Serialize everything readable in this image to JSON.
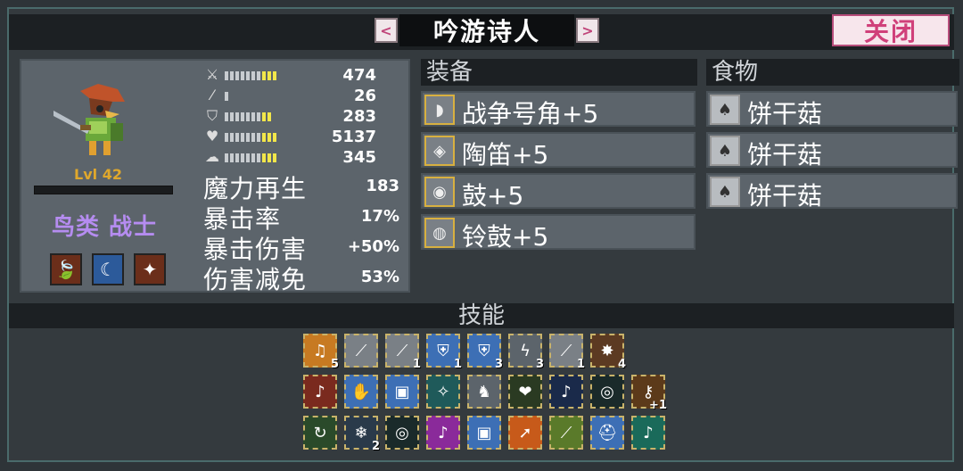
{
  "header": {
    "title": "吟游诗人",
    "prev_label": "<",
    "next_label": ">",
    "close_label": "关闭"
  },
  "character": {
    "level": "Lvl 42",
    "class": "鸟类 战士",
    "traits": [
      {
        "icon": "leaf-arrow-up-icon",
        "color": "#6b2e1a"
      },
      {
        "icon": "moon-shield-icon",
        "color": "#2c5a9a"
      },
      {
        "icon": "sparkle-icon",
        "color": "#6b2e1a"
      }
    ],
    "stats": [
      {
        "icon": "sword-icon",
        "value": "474",
        "pips": 10,
        "yellow": 3
      },
      {
        "icon": "wand-icon",
        "value": "26",
        "pips": 1,
        "yellow": 0
      },
      {
        "icon": "shield-icon",
        "value": "283",
        "pips": 9,
        "yellow": 2
      },
      {
        "icon": "heart-icon",
        "value": "5137",
        "pips": 10,
        "yellow": 3
      },
      {
        "icon": "speed-icon",
        "value": "345",
        "pips": 10,
        "yellow": 3
      }
    ],
    "sub_stats": [
      {
        "label": "魔力再生",
        "value": "183"
      },
      {
        "label": "暴击率",
        "value": "17%"
      },
      {
        "label": "暴击伤害",
        "value": "+50%"
      },
      {
        "label": "伤害减免",
        "value": "53%"
      }
    ]
  },
  "equipment": {
    "header": "装备",
    "items": [
      {
        "label": "战争号角+5",
        "icon": "horn-icon"
      },
      {
        "label": "陶笛+5",
        "icon": "ocarina-icon"
      },
      {
        "label": "鼓+5",
        "icon": "drum-icon"
      },
      {
        "label": "铃鼓+5",
        "icon": "tambourine-icon"
      }
    ]
  },
  "food": {
    "header": "食物",
    "items": [
      {
        "label": "饼干菇",
        "icon": "mushroom-icon"
      },
      {
        "label": "饼干菇",
        "icon": "mushroom-icon"
      },
      {
        "label": "饼干菇",
        "icon": "mushroom-icon"
      }
    ]
  },
  "skills": {
    "header": "技能",
    "rows": [
      [
        {
          "icon": "music-notes-icon",
          "bg": "#c77a22",
          "count": "5"
        },
        {
          "icon": "feather-icon",
          "bg": "#7a8086",
          "count": ""
        },
        {
          "icon": "feather-icon",
          "bg": "#7a8086",
          "count": "1"
        },
        {
          "icon": "shield-spell-icon",
          "bg": "#3d6fb5",
          "count": "1"
        },
        {
          "icon": "shield-spell-icon",
          "bg": "#3d6fb5",
          "count": "3"
        },
        {
          "icon": "lightning-icon",
          "bg": "#5c646b",
          "count": "3"
        },
        {
          "icon": "feather-icon",
          "bg": "#7a8086",
          "count": "1"
        },
        {
          "icon": "burst-icon",
          "bg": "#5c3a22",
          "count": "4"
        }
      ],
      [
        {
          "icon": "music-note-icon",
          "bg": "#7a2a1e",
          "count": ""
        },
        {
          "icon": "hand-icon",
          "bg": "#3d6fb5",
          "count": ""
        },
        {
          "icon": "armor-icon",
          "bg": "#3d6fb5",
          "count": ""
        },
        {
          "icon": "wand-sparkle-icon",
          "bg": "#1f5a5a",
          "count": ""
        },
        {
          "icon": "knight-icon",
          "bg": "#5c646b",
          "count": ""
        },
        {
          "icon": "heart-berry-icon",
          "bg": "#2a3a22",
          "count": ""
        },
        {
          "icon": "music-note-icon",
          "bg": "#1a2a4a",
          "count": ""
        },
        {
          "icon": "ring-icon",
          "bg": "#1a2a2a",
          "count": ""
        },
        {
          "icon": "key-plus-icon",
          "bg": "#5c3a1a",
          "count": "+1"
        }
      ],
      [
        {
          "icon": "swirl-icon",
          "bg": "#2a4a2a",
          "count": ""
        },
        {
          "icon": "frost-icon",
          "bg": "#2a3a4a",
          "count": "2"
        },
        {
          "icon": "ring-icon",
          "bg": "#1a2a2a",
          "count": ""
        },
        {
          "icon": "music-note-icon",
          "bg": "#8a2a9a",
          "count": ""
        },
        {
          "icon": "armor-icon",
          "bg": "#3d6fb5",
          "count": ""
        },
        {
          "icon": "arrow-icon",
          "bg": "#c75a1a",
          "count": ""
        },
        {
          "icon": "feather-icon",
          "bg": "#5a7a2a",
          "count": ""
        },
        {
          "icon": "helmet-icon",
          "bg": "#3d6fb5",
          "count": ""
        },
        {
          "icon": "music-note-icon",
          "bg": "#1a6a5a",
          "count": ""
        }
      ]
    ]
  }
}
